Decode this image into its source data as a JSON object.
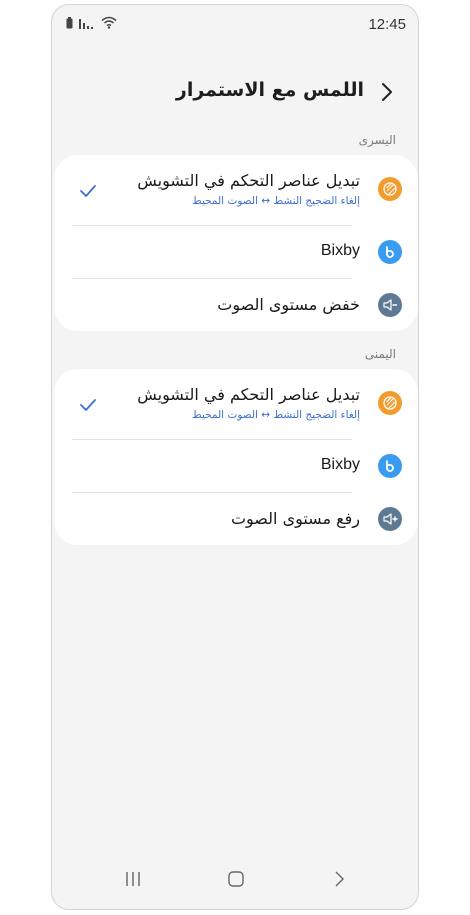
{
  "status_bar": {
    "time": "12:45",
    "icons": [
      "battery-icon",
      "signal-icon",
      "wifi-icon"
    ]
  },
  "header": {
    "title": "اللمس مع الاستمرار",
    "back_icon": "chevron-back-icon"
  },
  "left": {
    "section_label": "اليسرى",
    "items": [
      {
        "title": "تبديل عناصر التحكم في التشويش",
        "subtitle": "إلغاء الضجيج النشط ↔ الصوت المحيط",
        "icon": "noise-control-icon",
        "icon_color": "#f39c2d",
        "selected": true
      },
      {
        "title": "Bixby",
        "icon": "bixby-icon",
        "icon_color": "#3a9cf0",
        "selected": false
      },
      {
        "title": "خفض مستوى الصوت",
        "icon": "volume-down-icon",
        "icon_color": "#5e7a93",
        "selected": false
      }
    ]
  },
  "right": {
    "section_label": "اليمنى",
    "items": [
      {
        "title": "تبديل عناصر التحكم في التشويش",
        "subtitle": "إلغاء الضجيج النشط ↔ الصوت المحيط",
        "icon": "noise-control-icon",
        "icon_color": "#f39c2d",
        "selected": true
      },
      {
        "title": "Bixby",
        "icon": "bixby-icon",
        "icon_color": "#3a9cf0",
        "selected": false
      },
      {
        "title": "رفع مستوى الصوت",
        "icon": "volume-up-icon",
        "icon_color": "#5e7a93",
        "selected": false
      }
    ]
  },
  "nav_bar": {
    "buttons": [
      "recents-icon",
      "home-icon",
      "back-icon"
    ]
  },
  "colors": {
    "accent": "#3e6fcf",
    "background": "#f4f4f4",
    "card": "#ffffff"
  }
}
